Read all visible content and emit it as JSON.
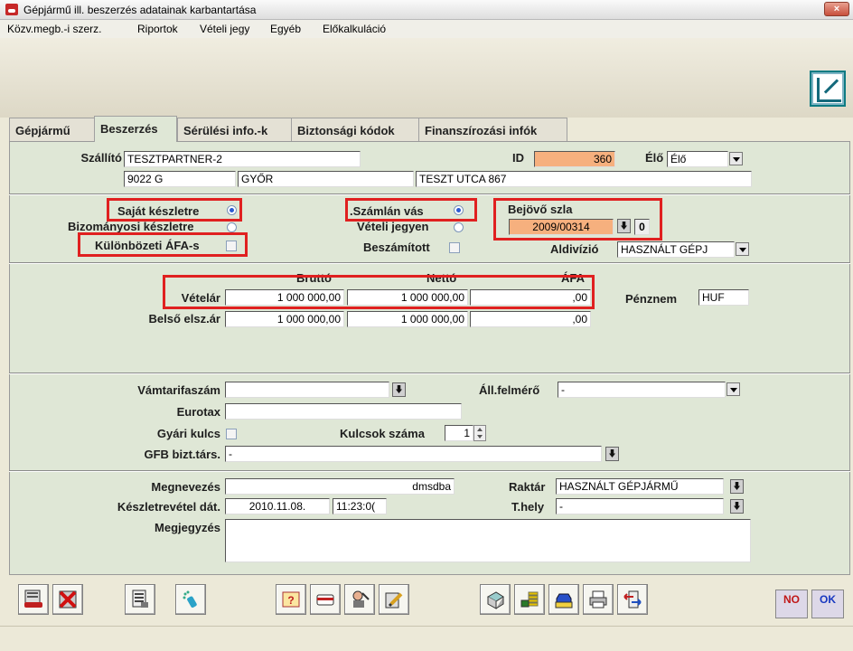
{
  "window": {
    "title": "Gépjármű ill. beszerzés adatainak karbantartása",
    "close": "×"
  },
  "menu": [
    "Közv.megb.-i szerz.",
    "Riportok",
    "Vételi jegy",
    "Egyéb",
    "Előkalkuláció"
  ],
  "tabs": [
    "Gépjármű",
    "Beszerzés",
    "Sérülési info.-k",
    "Biztonsági kódok",
    "Finanszírozási infók"
  ],
  "active_tab": "Beszerzés",
  "supplier": {
    "label": "Szállító",
    "name": "TESZTPARTNER-2",
    "zip": "9022 G",
    "city": "GYŐR",
    "street": "TESZT UTCA 867",
    "id_label": "ID",
    "id": "360",
    "live_label": "Élő",
    "live_value": "Élő"
  },
  "options": {
    "own_stock": "Saját készletre",
    "consign_stock": "Bizományosi készletre",
    "margin_vat": "Különbözeti ÁFA-s",
    "invoice_purchase": ".Számlán vás",
    "purchase_ticket": "Vételi jegyen",
    "offset": "Beszámított",
    "incoming_label": "Bejövő szla",
    "incoming_value": "2009/00314",
    "incoming_count": "0",
    "subdiv_label": "Aldivízió",
    "subdiv_value": "HASZNÁLT GÉPJ"
  },
  "prices": {
    "h_gross": "Bruttó",
    "h_net": "Nettó",
    "h_vat": "ÁFA",
    "buy_label": "Vételár",
    "buy_gross": "1 000 000,00",
    "buy_net": "1 000 000,00",
    "buy_vat": ",00",
    "internal_label": "Belső elsz.ár",
    "int_gross": "1 000 000,00",
    "int_net": "1 000 000,00",
    "int_vat": ",00",
    "currency_label": "Pénznem",
    "currency": "HUF"
  },
  "misc": {
    "tariff_label": "Vámtarifaszám",
    "tariff": "",
    "surveyor_label": "Áll.felmérő",
    "surveyor": "-",
    "eurotax_label": "Eurotax",
    "eurotax": "",
    "factory_key_label": "Gyári kulcs",
    "keys_label": "Kulcsok száma",
    "keys": "1",
    "insurer_label": "GFB bizt.társ.",
    "insurer": "-"
  },
  "stock": {
    "name_label": "Megnevezés",
    "name": "dmsdba",
    "warehouse_label": "Raktár",
    "warehouse": "HASZNÁLT GÉPJÁRMŰ",
    "date_label": "Készletrevétel dát.",
    "date": "2010.11.08.",
    "time": "11:23:0(",
    "place_label": "T.hely",
    "place": "-",
    "note_label": "Megjegyzés",
    "note": ""
  },
  "buttons": {
    "no": "NO",
    "ok": "OK"
  },
  "colors": {
    "panel": "#dfe7d6",
    "highlight": "#e02020",
    "id_field": "#f6b07e"
  }
}
